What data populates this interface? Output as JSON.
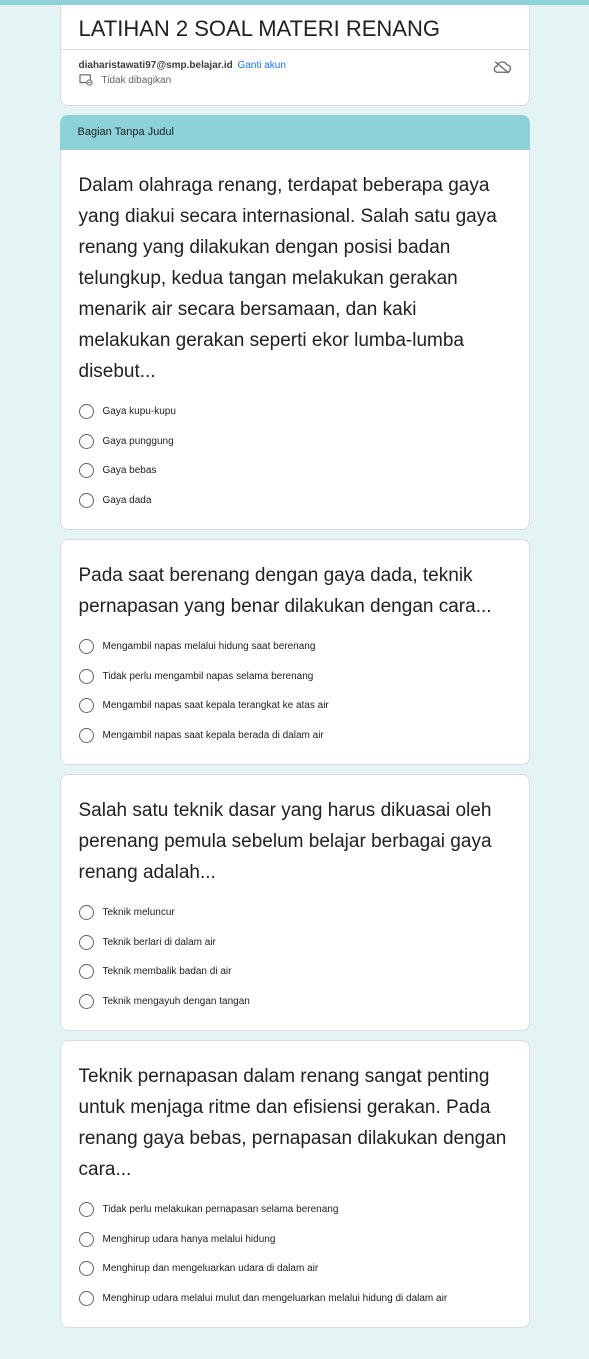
{
  "form": {
    "title": "LATIHAN 2 SOAL MATERI RENANG",
    "account_email": "diaharistawati97@smp.belajar.id",
    "switch_account": "Ganti akun",
    "not_shared": "Tidak dibagikan"
  },
  "section": {
    "title": "Bagian Tanpa Judul"
  },
  "questions": [
    {
      "text": "Dalam olahraga renang, terdapat beberapa gaya yang diakui secara internasional. Salah satu gaya renang yang dilakukan dengan posisi badan telungkup, kedua tangan melakukan gerakan menarik air secara bersamaan, dan kaki melakukan gerakan seperti ekor lumba-lumba disebut...",
      "options": [
        "Gaya kupu-kupu",
        "Gaya punggung",
        "Gaya bebas",
        "Gaya dada"
      ]
    },
    {
      "text": "Pada saat berenang dengan gaya dada, teknik pernapasan yang benar dilakukan dengan cara...",
      "options": [
        "Mengambil napas melalui hidung saat berenang",
        "Tidak perlu mengambil napas selama berenang",
        "Mengambil napas saat kepala terangkat ke atas air",
        "Mengambil napas saat kepala berada di dalam air"
      ]
    },
    {
      "text": "Salah satu teknik dasar yang harus dikuasai oleh perenang pemula sebelum belajar berbagai gaya renang adalah...",
      "options": [
        "Teknik meluncur",
        "Teknik berlari di dalam air",
        "Teknik membalik badan di air",
        "Teknik mengayuh dengan tangan"
      ]
    },
    {
      "text": "Teknik pernapasan dalam renang sangat penting untuk menjaga ritme dan efisiensi gerakan. Pada renang gaya bebas, pernapasan dilakukan dengan cara...",
      "options": [
        "Tidak perlu melakukan pernapasan selama berenang",
        "Menghirup udara hanya melalui hidung",
        "Menghirup dan mengeluarkan udara di dalam air",
        "Menghirup udara melalui mulut dan mengeluarkan melalui hidung di dalam air"
      ]
    }
  ]
}
